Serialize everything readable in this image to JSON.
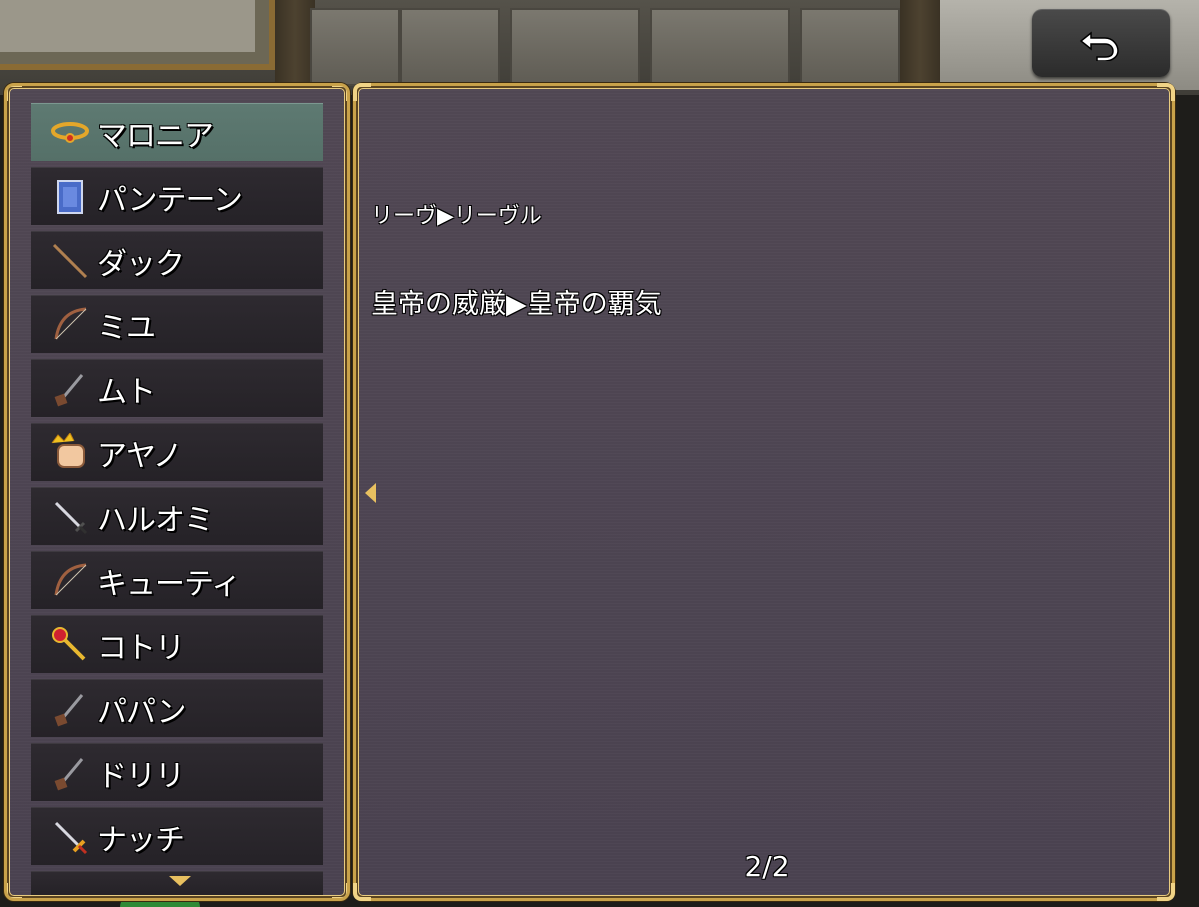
{
  "back_button": {
    "icon": "return-arrow-icon"
  },
  "characters": [
    {
      "name": "マロニア",
      "icon": "ring-icon",
      "selected": true
    },
    {
      "name": "パンテーン",
      "icon": "spellbook-icon",
      "selected": false
    },
    {
      "name": "ダック",
      "icon": "staff-icon",
      "selected": false
    },
    {
      "name": "ミユ",
      "icon": "bow-icon",
      "selected": false
    },
    {
      "name": "ムト",
      "icon": "gun-icon",
      "selected": false
    },
    {
      "name": "アヤノ",
      "icon": "fist-icon",
      "selected": false
    },
    {
      "name": "ハルオミ",
      "icon": "sword-icon",
      "selected": false
    },
    {
      "name": "キューティ",
      "icon": "bow-icon",
      "selected": false
    },
    {
      "name": "コトリ",
      "icon": "scepter-icon",
      "selected": false
    },
    {
      "name": "パパン",
      "icon": "gun-icon",
      "selected": false
    },
    {
      "name": "ドリリ",
      "icon": "gun-icon",
      "selected": false
    },
    {
      "name": "ナッチ",
      "icon": "golden-sword-icon",
      "selected": false
    }
  ],
  "detail": {
    "line1": "リーヴ▶リーヴル",
    "line2": "皇帝の威厳▶皇帝の覇気",
    "page_indicator": "2/2"
  },
  "colors": {
    "panel_border": "#c9a24a",
    "selected_row": "#5e7a72",
    "row": "#2e2a30",
    "panel_bg": "#4d4551",
    "arrow": "#e8c060"
  }
}
